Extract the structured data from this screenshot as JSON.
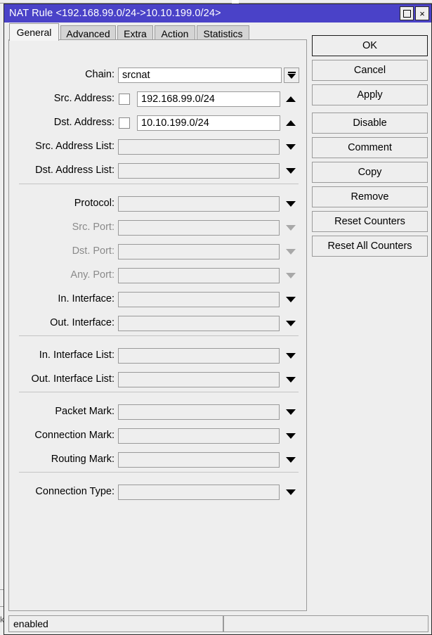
{
  "window": {
    "title": "NAT Rule <192.168.99.0/24->10.10.199.0/24>",
    "titlebar_color": "#4a42c8",
    "controls": {
      "maximize_label": "",
      "close_label": "×"
    }
  },
  "tabs": [
    {
      "label": "General",
      "active": true
    },
    {
      "label": "Advanced",
      "active": false
    },
    {
      "label": "Extra",
      "active": false
    },
    {
      "label": "Action",
      "active": false
    },
    {
      "label": "Statistics",
      "active": false
    }
  ],
  "form": {
    "fields": [
      {
        "label": "Chain:",
        "value": "srcnat",
        "control": "combo-button",
        "enabled": true,
        "checkbox": false
      },
      {
        "label": "Src. Address:",
        "value": "192.168.99.0/24",
        "control": "arrow-up",
        "enabled": true,
        "checkbox": true,
        "checked": false
      },
      {
        "label": "Dst. Address:",
        "value": "10.10.199.0/24",
        "control": "arrow-up",
        "enabled": true,
        "checkbox": true,
        "checked": false
      },
      {
        "label": "Src. Address List:",
        "value": "",
        "control": "arrow-down",
        "enabled": true,
        "checkbox": false
      },
      {
        "label": "Dst. Address List:",
        "value": "",
        "control": "arrow-down",
        "enabled": true,
        "checkbox": false
      },
      {
        "label": "Protocol:",
        "value": "",
        "control": "arrow-down",
        "enabled": true,
        "checkbox": false
      },
      {
        "label": "Src. Port:",
        "value": "",
        "control": "arrow-down",
        "enabled": false,
        "checkbox": false
      },
      {
        "label": "Dst. Port:",
        "value": "",
        "control": "arrow-down",
        "enabled": false,
        "checkbox": false
      },
      {
        "label": "Any. Port:",
        "value": "",
        "control": "arrow-down",
        "enabled": false,
        "checkbox": false
      },
      {
        "label": "In. Interface:",
        "value": "",
        "control": "arrow-down",
        "enabled": true,
        "checkbox": false
      },
      {
        "label": "Out. Interface:",
        "value": "",
        "control": "arrow-down",
        "enabled": true,
        "checkbox": false
      },
      {
        "label": "In. Interface List:",
        "value": "",
        "control": "arrow-down",
        "enabled": true,
        "checkbox": false
      },
      {
        "label": "Out. Interface List:",
        "value": "",
        "control": "arrow-down",
        "enabled": true,
        "checkbox": false
      },
      {
        "label": "Packet Mark:",
        "value": "",
        "control": "arrow-down",
        "enabled": true,
        "checkbox": false
      },
      {
        "label": "Connection Mark:",
        "value": "",
        "control": "arrow-down",
        "enabled": true,
        "checkbox": false
      },
      {
        "label": "Routing Mark:",
        "value": "",
        "control": "arrow-down",
        "enabled": true,
        "checkbox": false
      },
      {
        "label": "Connection Type:",
        "value": "",
        "control": "arrow-down",
        "enabled": true,
        "checkbox": false
      }
    ]
  },
  "buttons": [
    {
      "label": "OK",
      "default": true
    },
    {
      "label": "Cancel",
      "default": false
    },
    {
      "label": "Apply",
      "default": false
    },
    {
      "label": "Disable",
      "default": false
    },
    {
      "label": "Comment",
      "default": false
    },
    {
      "label": "Copy",
      "default": false
    },
    {
      "label": "Remove",
      "default": false
    },
    {
      "label": "Reset Counters",
      "default": false
    },
    {
      "label": "Reset All Counters",
      "default": false
    }
  ],
  "statusbar": {
    "left": "enabled",
    "right": ""
  }
}
